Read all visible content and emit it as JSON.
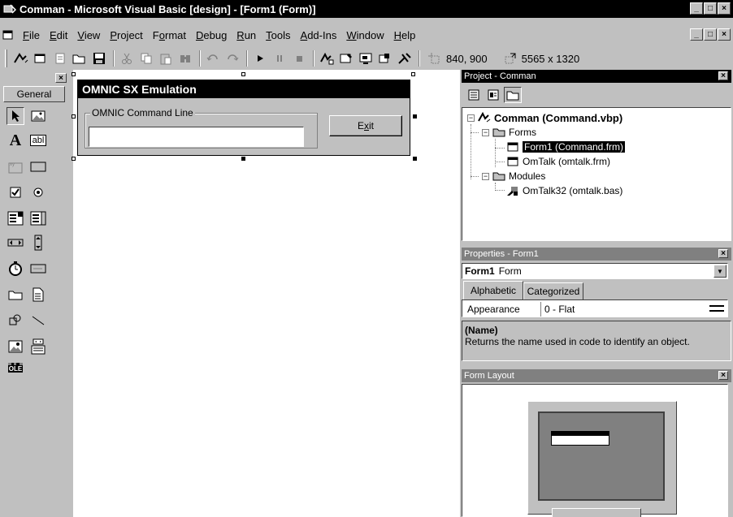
{
  "window": {
    "title": "Comman - Microsoft Visual Basic [design] - [Form1 (Form)]",
    "minimize": "_",
    "maximize": "□",
    "close": "×"
  },
  "menu": [
    {
      "pre": "",
      "u": "F",
      "post": "ile"
    },
    {
      "pre": "",
      "u": "E",
      "post": "dit"
    },
    {
      "pre": "",
      "u": "V",
      "post": "iew"
    },
    {
      "pre": "",
      "u": "P",
      "post": "roject"
    },
    {
      "pre": "F",
      "u": "o",
      "post": "rmat"
    },
    {
      "pre": "",
      "u": "D",
      "post": "ebug"
    },
    {
      "pre": "",
      "u": "R",
      "post": "un"
    },
    {
      "pre": "",
      "u": "T",
      "post": "ools"
    },
    {
      "pre": "",
      "u": "A",
      "post": "dd-Ins"
    },
    {
      "pre": "",
      "u": "W",
      "post": "indow"
    },
    {
      "pre": "",
      "u": "H",
      "post": "elp"
    }
  ],
  "toolbar": {
    "position": "840, 900",
    "size": "5565 x 1320"
  },
  "toolbox": {
    "tab": "General",
    "close": "×",
    "label_tool": "A",
    "textbox_tool": "abl",
    "ole_tool": "OLE"
  },
  "form": {
    "caption": "OMNIC SX Emulation",
    "groupbox_label": "OMNIC Command Line",
    "command_input_value": "",
    "exit_pre": "E",
    "exit_u": "x",
    "exit_post": "it"
  },
  "project": {
    "title": "Project - Comman",
    "close": "×",
    "root": "Comman (Command.vbp)",
    "forms_folder": "Forms",
    "form1": "Form1 (Command.frm)",
    "omtalk": "OmTalk (omtalk.frm)",
    "modules_folder": "Modules",
    "omtalk32": "OmTalk32 (omtalk.bas)"
  },
  "properties": {
    "title": "Properties - Form1",
    "close": "×",
    "object_name": "Form1",
    "object_type": "Form",
    "tab_alphabetic": "Alphabetic",
    "tab_categorized": "Categorized",
    "prop_name": "Appearance",
    "prop_value": "0 - Flat",
    "desc_title": "(Name)",
    "desc_text": "Returns the name used in code to identify an object."
  },
  "layout": {
    "title": "Form Layout",
    "close": "×"
  }
}
